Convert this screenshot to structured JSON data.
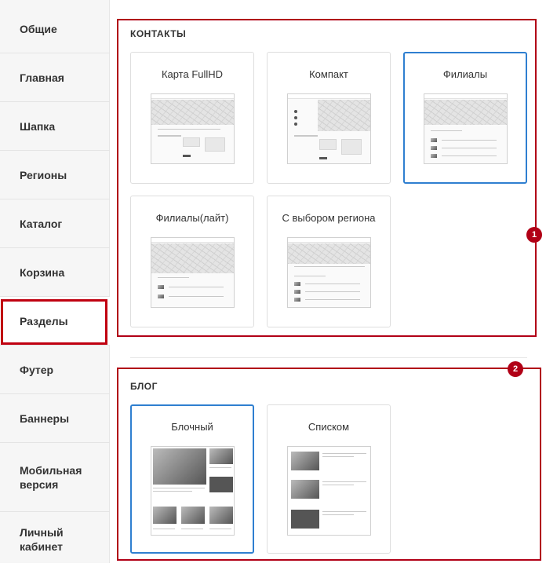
{
  "sidebar": {
    "items": [
      {
        "label": "Общие"
      },
      {
        "label": "Главная"
      },
      {
        "label": "Шапка"
      },
      {
        "label": "Регионы"
      },
      {
        "label": "Каталог"
      },
      {
        "label": "Корзина"
      },
      {
        "label": "Разделы",
        "active": true
      },
      {
        "label": "Футер"
      },
      {
        "label": "Баннеры"
      },
      {
        "label": "Мобильная версия"
      },
      {
        "label": "Личный кабинет"
      }
    ]
  },
  "sections": {
    "contacts": {
      "title": "КОНТАКТЫ",
      "badge": "1",
      "cards": [
        {
          "label": "Карта FullHD"
        },
        {
          "label": "Компакт"
        },
        {
          "label": "Филиалы",
          "selected": true
        },
        {
          "label": "Филиалы(лайт)"
        },
        {
          "label": "С выбором региона"
        }
      ]
    },
    "blog": {
      "title": "БЛОГ",
      "badge": "2",
      "cards": [
        {
          "label": "Блочный",
          "selected": true
        },
        {
          "label": "Списком"
        }
      ]
    }
  },
  "colors": {
    "highlight": "#b10016",
    "selected_border": "#2f7fd0"
  }
}
